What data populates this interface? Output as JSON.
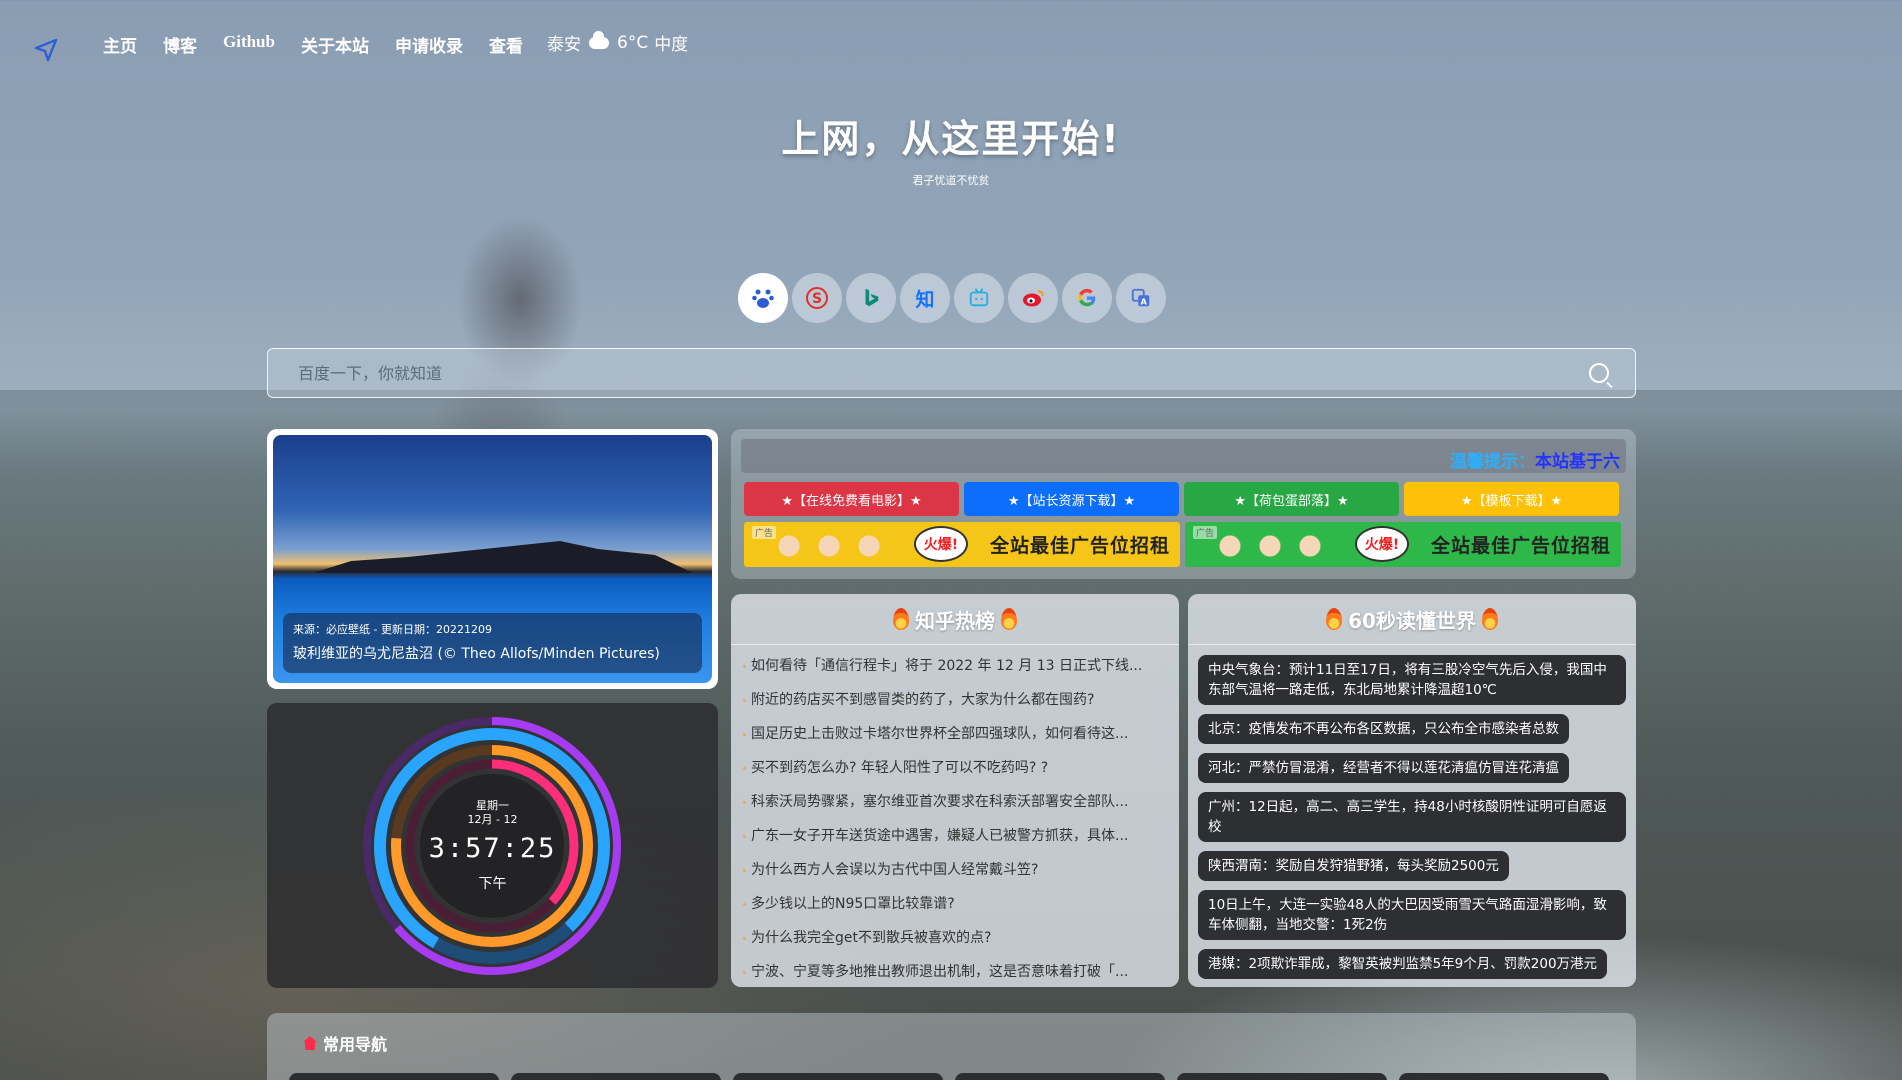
{
  "nav": {
    "items": [
      "主页",
      "博客",
      "Github",
      "关于本站",
      "申请收录",
      "查看"
    ],
    "weather": {
      "city": "泰安",
      "temp": "6°C",
      "level": "中度"
    }
  },
  "hero": {
    "title": "上网，从这里开始!",
    "subtitle": "君子忧道不忧贫"
  },
  "engines": [
    {
      "name": "baidu-icon",
      "glyph": "🐾"
    },
    {
      "name": "sogou-icon",
      "glyph": "S"
    },
    {
      "name": "bing-icon",
      "glyph": "b"
    },
    {
      "name": "zhihu-icon",
      "glyph": "知"
    },
    {
      "name": "bilibili-icon",
      "glyph": "▣"
    },
    {
      "name": "weibo-icon",
      "glyph": "◉"
    },
    {
      "name": "google-icon",
      "glyph": "G"
    },
    {
      "name": "translate-icon",
      "glyph": "▤"
    }
  ],
  "search": {
    "placeholder": "百度一下，你就知道"
  },
  "bing": {
    "source": "来源：必应壁纸 - 更新日期：20221209",
    "title": "玻利维亚的乌尤尼盐沼 (© Theo Allofs/Minden Pictures)"
  },
  "clock": {
    "weekday": "星期一",
    "date": "12月 - 12",
    "time": "3:57:25",
    "ampm": "下午"
  },
  "notice": {
    "prefix": "温馨提示：",
    "text": "本站基于六"
  },
  "ad_buttons": [
    {
      "label": "★【在线免费看电影】★",
      "color": "#dc3545"
    },
    {
      "label": "★【站长资源下载】★",
      "color": "#0d6efd"
    },
    {
      "label": "★【荷包蛋部落】★",
      "color": "#28a745"
    },
    {
      "label": "★【模板下载】★",
      "color": "#ffc107"
    }
  ],
  "banners": [
    {
      "tag": "广告",
      "hot": "火爆!",
      "text": "全站最佳广告位招租",
      "bg": "#f5c518"
    },
    {
      "tag": "广告",
      "hot": "火爆!",
      "text": "全站最佳广告位招租",
      "bg": "#2fb84a"
    }
  ],
  "zhihu": {
    "title": "知乎热榜",
    "items": [
      "如何看待「通信行程卡」将于 2022 年 12 月 13 日正式下线...",
      "附近的药店买不到感冒类的药了，大家为什么都在囤药?",
      "国足历史上击败过卡塔尔世界杯全部四强球队，如何看待这...",
      "买不到药怎么办? 年轻人阳性了可以不吃药吗? ?",
      "科索沃局势骤紧，塞尔维亚首次要求在科索沃部署安全部队...",
      "广东一女子开车送货途中遇害，嫌疑人已被警方抓获，具体...",
      "为什么西方人会误以为古代中国人经常戴斗笠?",
      "多少钱以上的N95口罩比较靠谱?",
      "为什么我完全get不到散兵被喜欢的点?",
      "宁波、宁夏等多地推出教师退出机制，这是否意味着打破「..."
    ]
  },
  "news60": {
    "title": "60秒读懂世界",
    "items": [
      "中央气象台：预计11日至17日，将有三股冷空气先后入侵，我国中东部气温将一路走低，东北局地累计降温超10℃",
      "北京：疫情发布不再公布各区数据，只公布全市感染者总数",
      "河北：严禁仿冒混淆，经营者不得以莲花清瘟仿冒连花清瘟",
      "广州：12日起，高二、高三学生，持48小时核酸阴性证明可自愿返校",
      "陕西渭南：奖励自发狩猎野猪，每头奖励2500元",
      "10日上午，大连一实验48人的大巴因受雨雪天气路面湿滑影响，致车体侧翻，当地交警：1死2伤",
      "港媒：2项欺诈罪成，黎智英被判监禁5年9个月、罚款200万港元"
    ]
  },
  "common_nav": {
    "title": "常用导航"
  }
}
